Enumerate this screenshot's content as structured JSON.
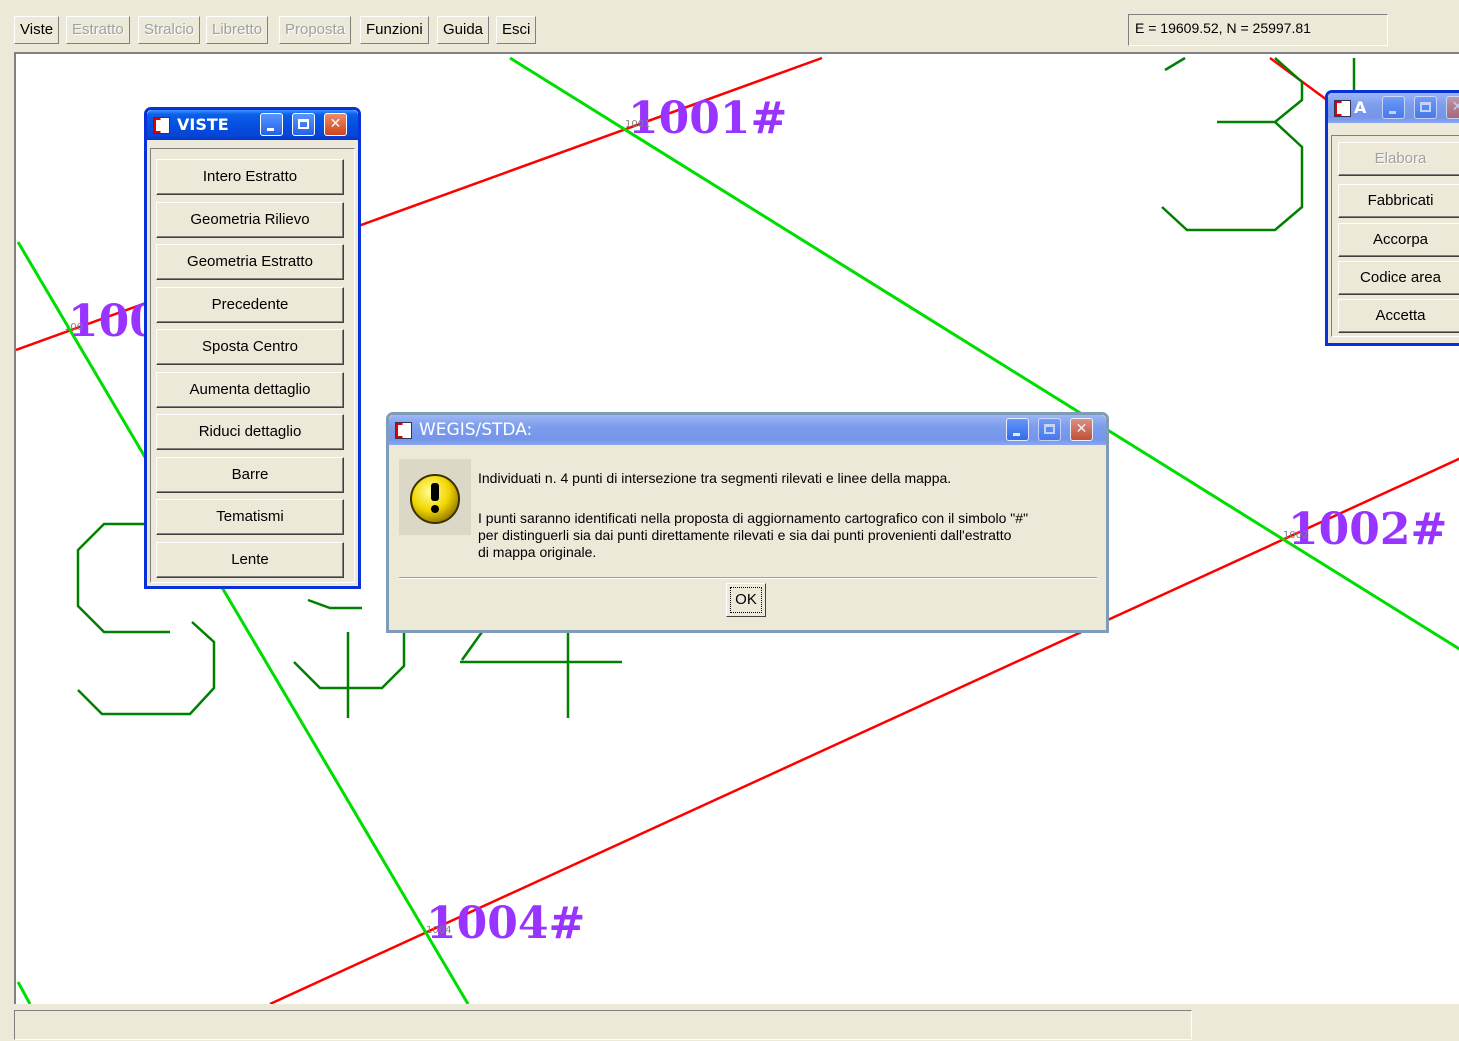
{
  "menu": {
    "items": [
      {
        "label": "Viste",
        "enabled": true
      },
      {
        "label": "Estratto",
        "enabled": false
      },
      {
        "label": "Stralcio",
        "enabled": false
      },
      {
        "label": "Libretto",
        "enabled": false
      },
      {
        "label": "Proposta",
        "enabled": false
      },
      {
        "label": "Funzioni",
        "enabled": true
      },
      {
        "label": "Guida",
        "enabled": true
      },
      {
        "label": "Esci",
        "enabled": true
      }
    ]
  },
  "coords": {
    "text": "E = 19609.52,  N = 25997.81"
  },
  "map": {
    "labels": [
      "1001#",
      "1002#",
      "1004#",
      "100"
    ],
    "small_labels": [
      "1001",
      "1002",
      "1004",
      "100"
    ],
    "colors": {
      "green_line": "#00dd00",
      "red_line": "#ff0000",
      "dark_green": "#008000",
      "label": "#9933ff"
    }
  },
  "viste_window": {
    "title": "VISTE",
    "buttons": [
      "Intero Estratto",
      "Geometria Rilievo",
      "Geometria Estratto",
      "Precedente",
      "Sposta Centro",
      "Aumenta dettaglio",
      "Riduci dettaglio",
      "Barre",
      "Tematismi",
      "Lente"
    ]
  },
  "a_window": {
    "title": "A",
    "buttons": [
      {
        "label": "Elabora",
        "enabled": false
      },
      {
        "label": "Fabbricati",
        "enabled": true
      },
      {
        "label": "Accorpa",
        "enabled": true
      },
      {
        "label": "Codice area",
        "enabled": true
      },
      {
        "label": "Accetta",
        "enabled": true
      }
    ]
  },
  "dialog": {
    "title": "WEGIS/STDA:",
    "line1": "Individuati n. 4 punti di intersezione tra segmenti rilevati e linee della mappa.",
    "line2": "I punti saranno identificati nella proposta di aggiornamento cartografico con il simbolo \"#\"",
    "line3": "per distinguerli sia dai punti direttamente rilevati e sia dai punti provenienti dall'estratto",
    "line4": "di mappa originale.",
    "ok_label": "OK",
    "icon": "warning-icon"
  }
}
